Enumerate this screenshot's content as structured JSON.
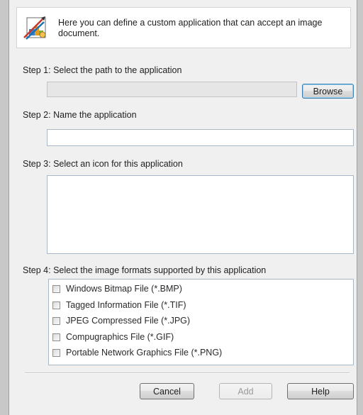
{
  "header": {
    "description": "Here you can define a custom application that can accept an image document."
  },
  "step1": {
    "label": "Step 1: Select the path to the application",
    "path_value": "",
    "browse_label": "Browse"
  },
  "step2": {
    "label": "Step 2: Name the application",
    "name_value": ""
  },
  "step3": {
    "label": "Step 3: Select an icon for this application"
  },
  "step4": {
    "label": "Step 4: Select the image formats supported by this application",
    "formats": [
      {
        "label": "Windows Bitmap File (*.BMP)",
        "checked": false
      },
      {
        "label": "Tagged Information File (*.TIF)",
        "checked": false
      },
      {
        "label": "JPEG Compressed File (*.JPG)",
        "checked": false
      },
      {
        "label": "Compugraphics File (*.GIF)",
        "checked": false
      },
      {
        "label": "Portable Network Graphics File (*.PNG)",
        "checked": false
      }
    ]
  },
  "buttons": {
    "cancel": "Cancel",
    "add": "Add",
    "help": "Help"
  },
  "icons": {
    "header": "custom-application-icon"
  }
}
